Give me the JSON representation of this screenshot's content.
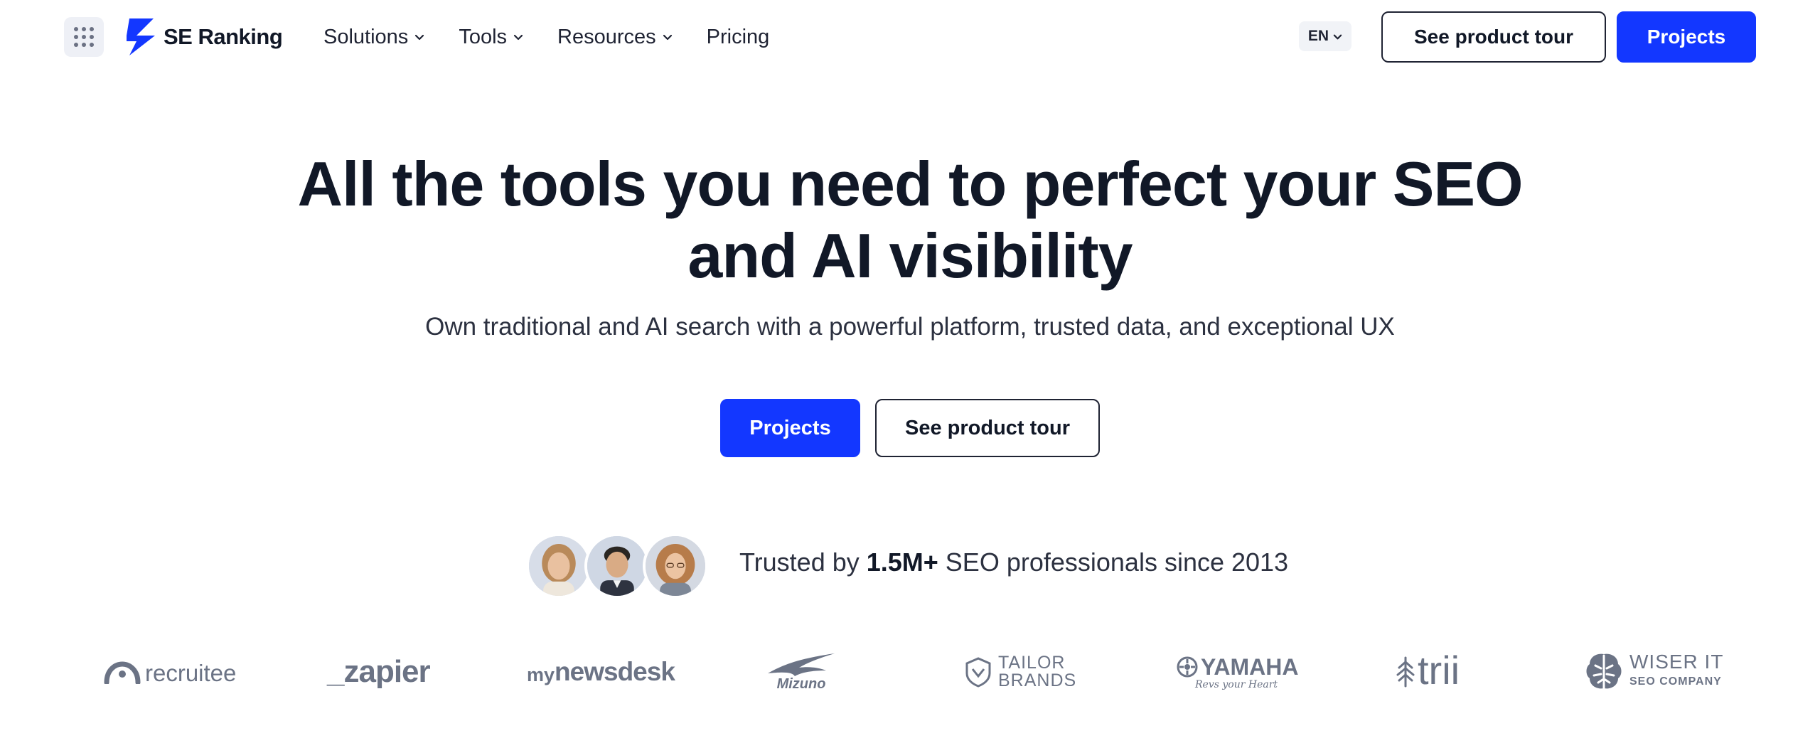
{
  "header": {
    "logo_text": "SE Ranking",
    "nav": [
      {
        "label": "Solutions"
      },
      {
        "label": "Tools"
      },
      {
        "label": "Resources"
      },
      {
        "label": "Pricing"
      }
    ],
    "language": "EN",
    "tour_button": "See product tour",
    "projects_button": "Projects"
  },
  "hero": {
    "title_line1": "All the tools you need to perfect your SEO",
    "title_line2": "and AI visibility",
    "subtitle": "Own traditional and AI search with a powerful platform, trusted data, and exceptional UX",
    "projects_button": "Projects",
    "tour_button": "See product tour"
  },
  "trusted": {
    "prefix": "Trusted by ",
    "highlight": "1.5M+",
    "suffix": " SEO professionals since 2013"
  },
  "brands": {
    "recruitee": "recruitee",
    "zapier": "_zapier",
    "mynewsdesk_my": "my",
    "mynewsdesk_main": "newsdesk",
    "mizuno": "Mizuno",
    "tailor_line1": "TAILOR",
    "tailor_line2": "BRANDS",
    "yamaha": "YAMAHA",
    "yamaha_tagline": "Revs your Heart",
    "trii": "trii",
    "wiser_line1": "WISER IT",
    "wiser_line2": "SEO COMPANY"
  },
  "colors": {
    "primary": "#1337ff",
    "text": "#111827",
    "logo_gray": "#6b7385"
  }
}
